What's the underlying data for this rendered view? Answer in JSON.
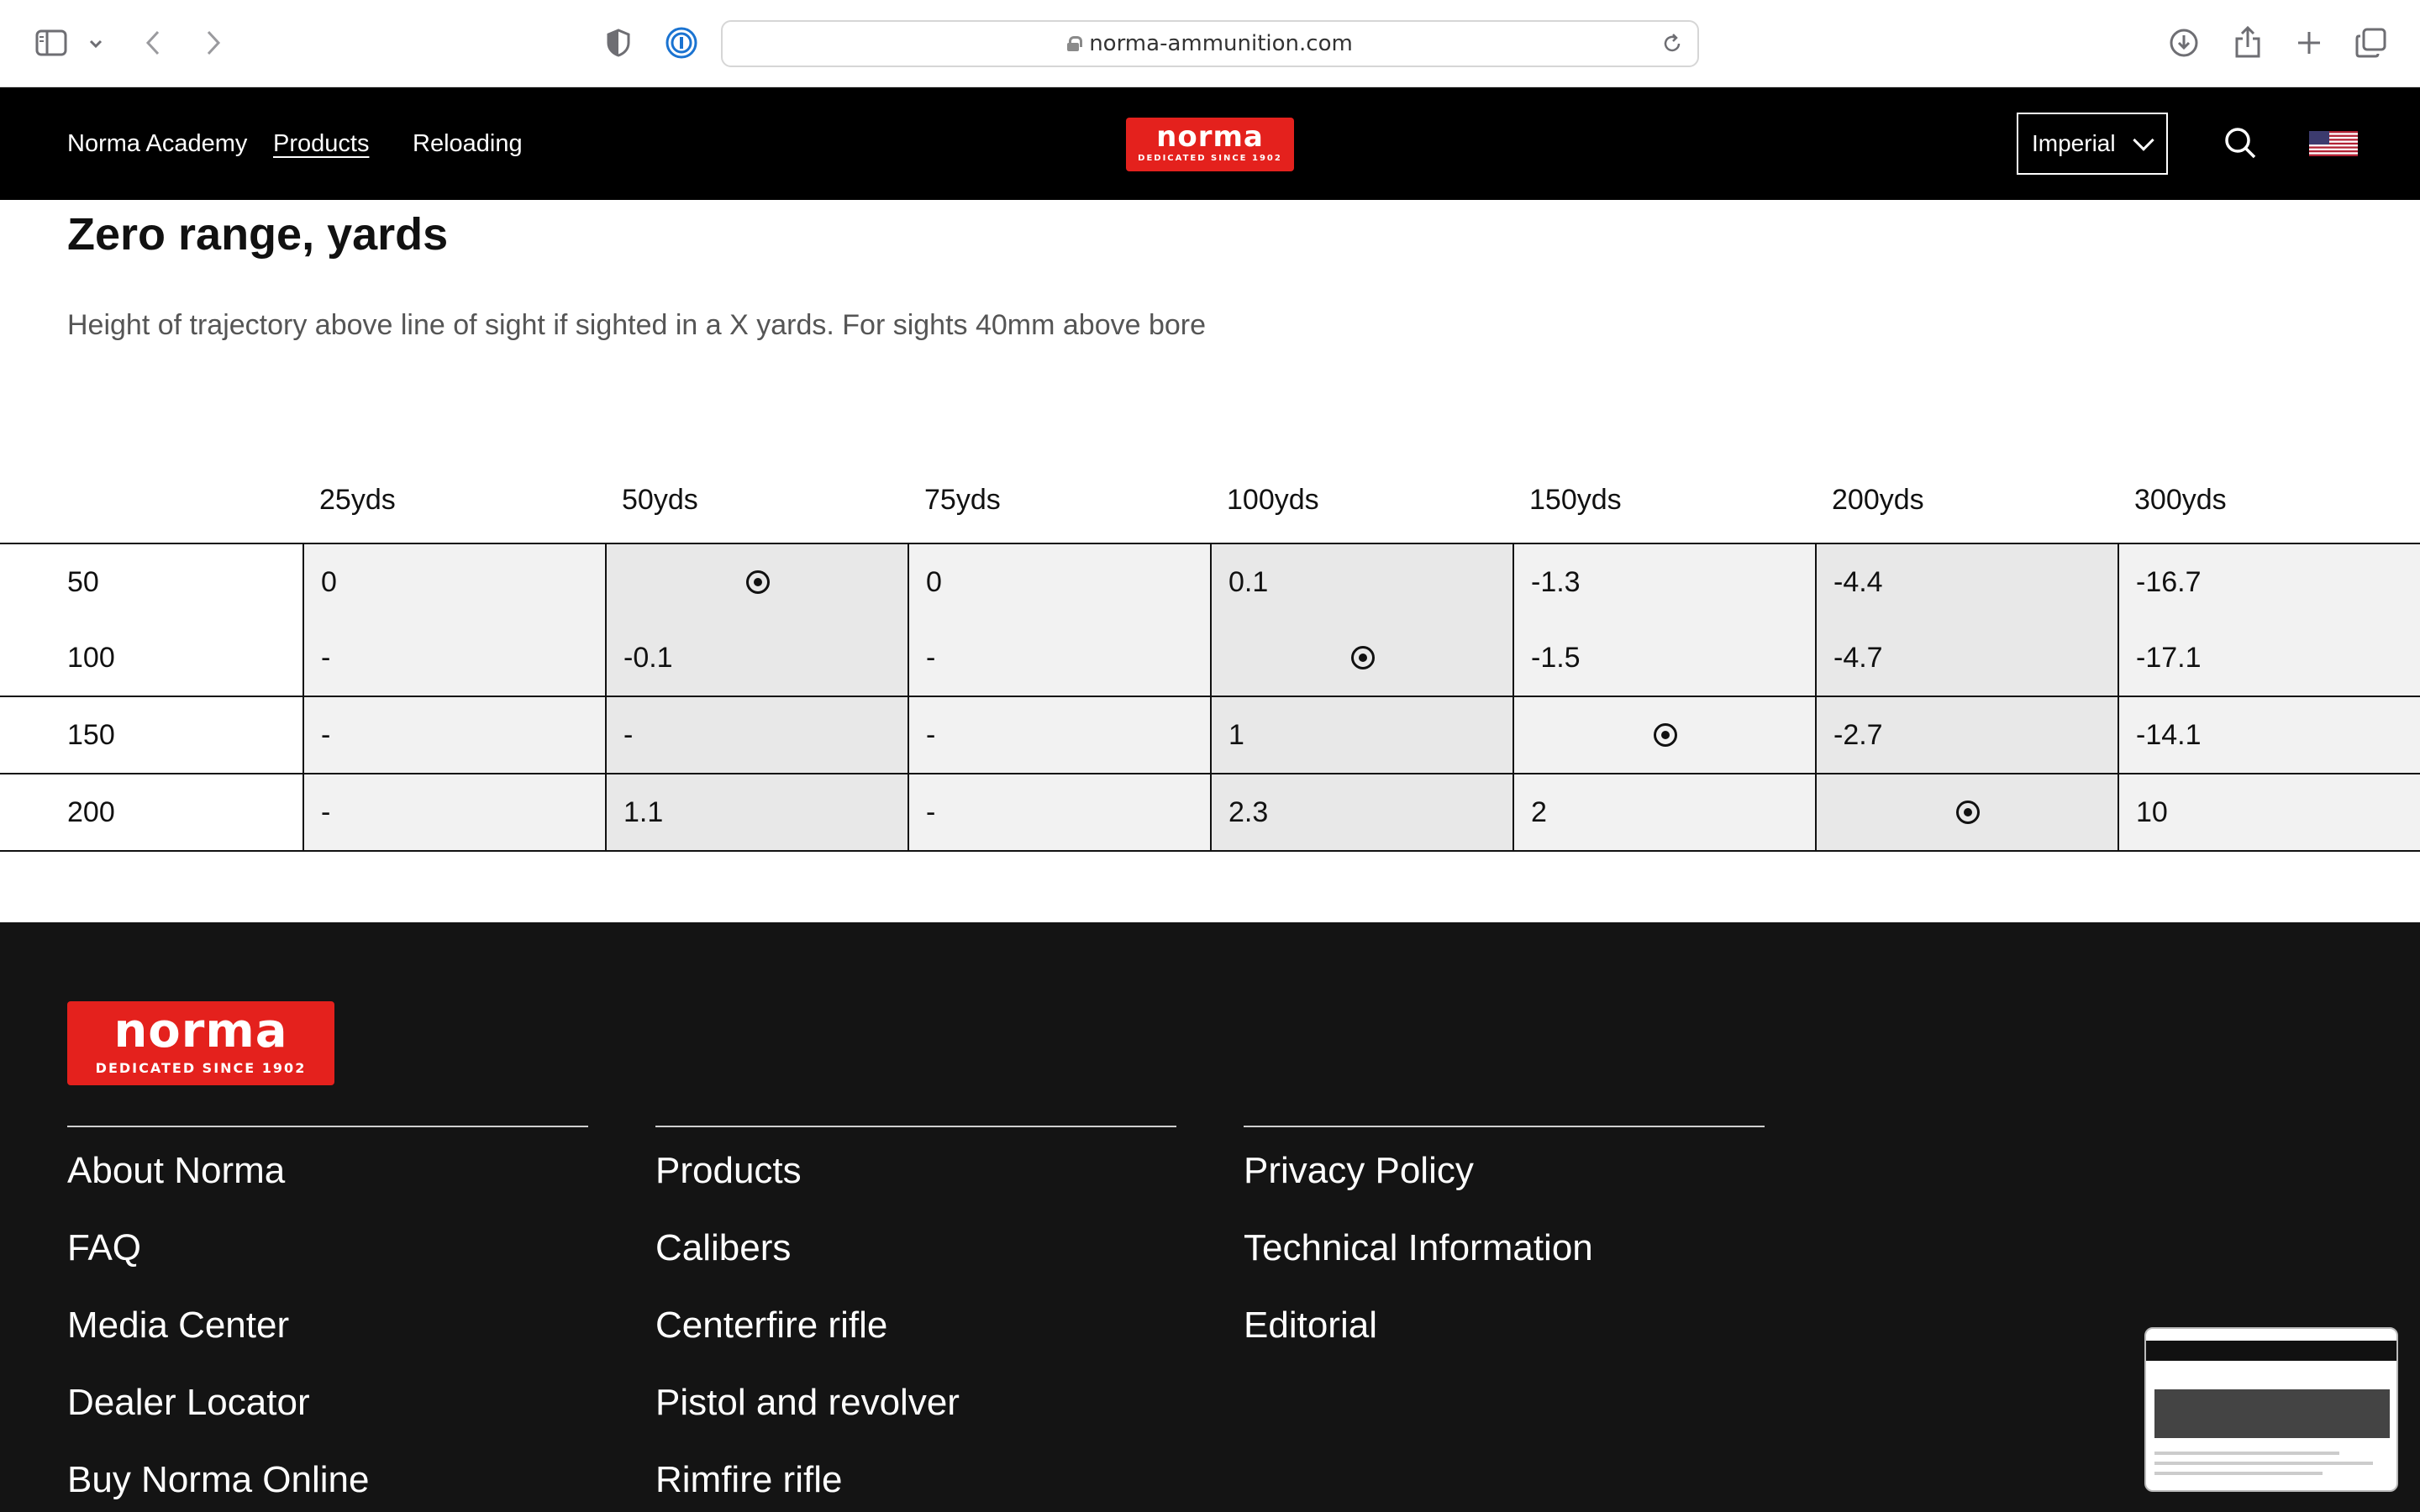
{
  "browser": {
    "url": "norma-ammunition.com"
  },
  "header": {
    "nav": [
      "Norma Academy",
      "Products",
      "Reloading"
    ],
    "logo_word": "norma",
    "logo_tagline": "DEDICATED SINCE 1902",
    "units_select": "Imperial"
  },
  "section": {
    "title": "Zero range, yards",
    "subtitle": "Height of trajectory above line of sight if sighted in a X yards. For sights 40mm above bore"
  },
  "table": {
    "columns": [
      "25yds",
      "50yds",
      "75yds",
      "100yds",
      "150yds",
      "200yds",
      "300yds"
    ],
    "rows": [
      {
        "label": "50",
        "cells": [
          "0",
          "",
          "0",
          "0.1",
          "-1.3",
          "-4.4",
          "-16.7"
        ]
      },
      {
        "label": "100",
        "cells": [
          "-",
          "-0.1",
          "-",
          "",
          "-1.5",
          "-4.7",
          "-17.1"
        ]
      },
      {
        "label": "150",
        "cells": [
          "-",
          "-",
          "-",
          "1",
          "",
          "-2.7",
          "-14.1"
        ]
      },
      {
        "label": "200",
        "cells": [
          "-",
          "1.1",
          "-",
          "2.3",
          "2",
          "",
          "10"
        ]
      }
    ]
  },
  "footer": {
    "logo_word": "norma",
    "logo_tagline": "DEDICATED SINCE 1902",
    "columns": [
      [
        "About Norma",
        "FAQ",
        "Media Center",
        "Dealer Locator",
        "Buy Norma Online"
      ],
      [
        "Products",
        "Calibers",
        "Centerfire rifle",
        "Pistol and revolver",
        "Rimfire rifle"
      ],
      [
        "Privacy Policy",
        "Technical Information",
        "Editorial"
      ]
    ]
  },
  "colors": {
    "brand_red": "#e4211d",
    "header_bg": "#000000",
    "footer_bg": "#141414"
  },
  "icons": [
    "sidebar-icon",
    "chevron-down-icon",
    "back-icon",
    "forward-icon",
    "shield-icon",
    "password-icon",
    "lock-icon",
    "reload-icon",
    "download-icon",
    "share-icon",
    "plus-icon",
    "tabs-icon",
    "search-icon",
    "us-flag-icon",
    "target-icon"
  ]
}
